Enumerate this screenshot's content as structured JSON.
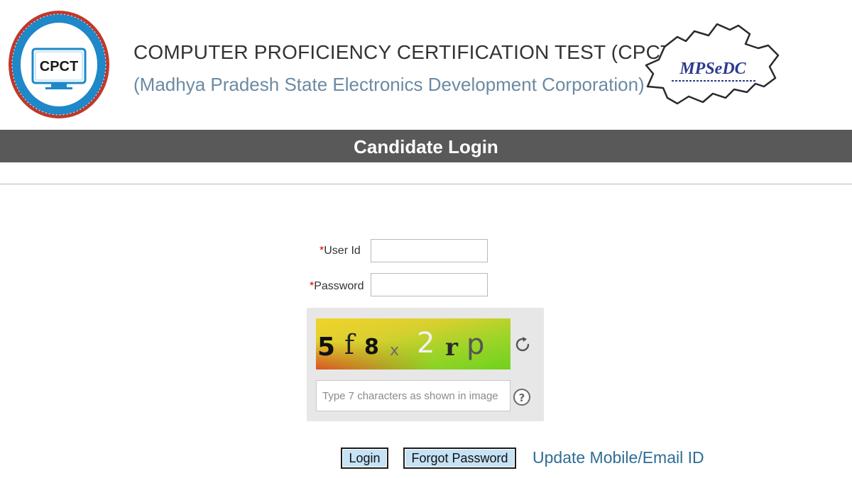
{
  "header": {
    "seal_text": "CPCT",
    "title": "COMPUTER PROFICIENCY CERTIFICATION TEST (CPCT)",
    "subtitle": "(Madhya Pradesh State Electronics Development Corporation)",
    "logo_text": "MPSeDC"
  },
  "banner": {
    "title": "Candidate Login"
  },
  "form": {
    "required_mark": "*",
    "user_id_label": "User Id",
    "user_id_value": "",
    "password_label": "Password",
    "password_value": "",
    "captcha_text": "5f8x2rp",
    "captcha_placeholder": "Type 7 characters as shown in image",
    "help_symbol": "?"
  },
  "actions": {
    "login_label": "Login",
    "forgot_password_label": "Forgot Password",
    "update_link_label": "Update Mobile/Email ID"
  },
  "colors": {
    "banner_bg": "#595959",
    "subtitle": "#6b8aa3",
    "required": "#d60000",
    "button_bg": "#c6e2f5",
    "link": "#2f6d95"
  }
}
